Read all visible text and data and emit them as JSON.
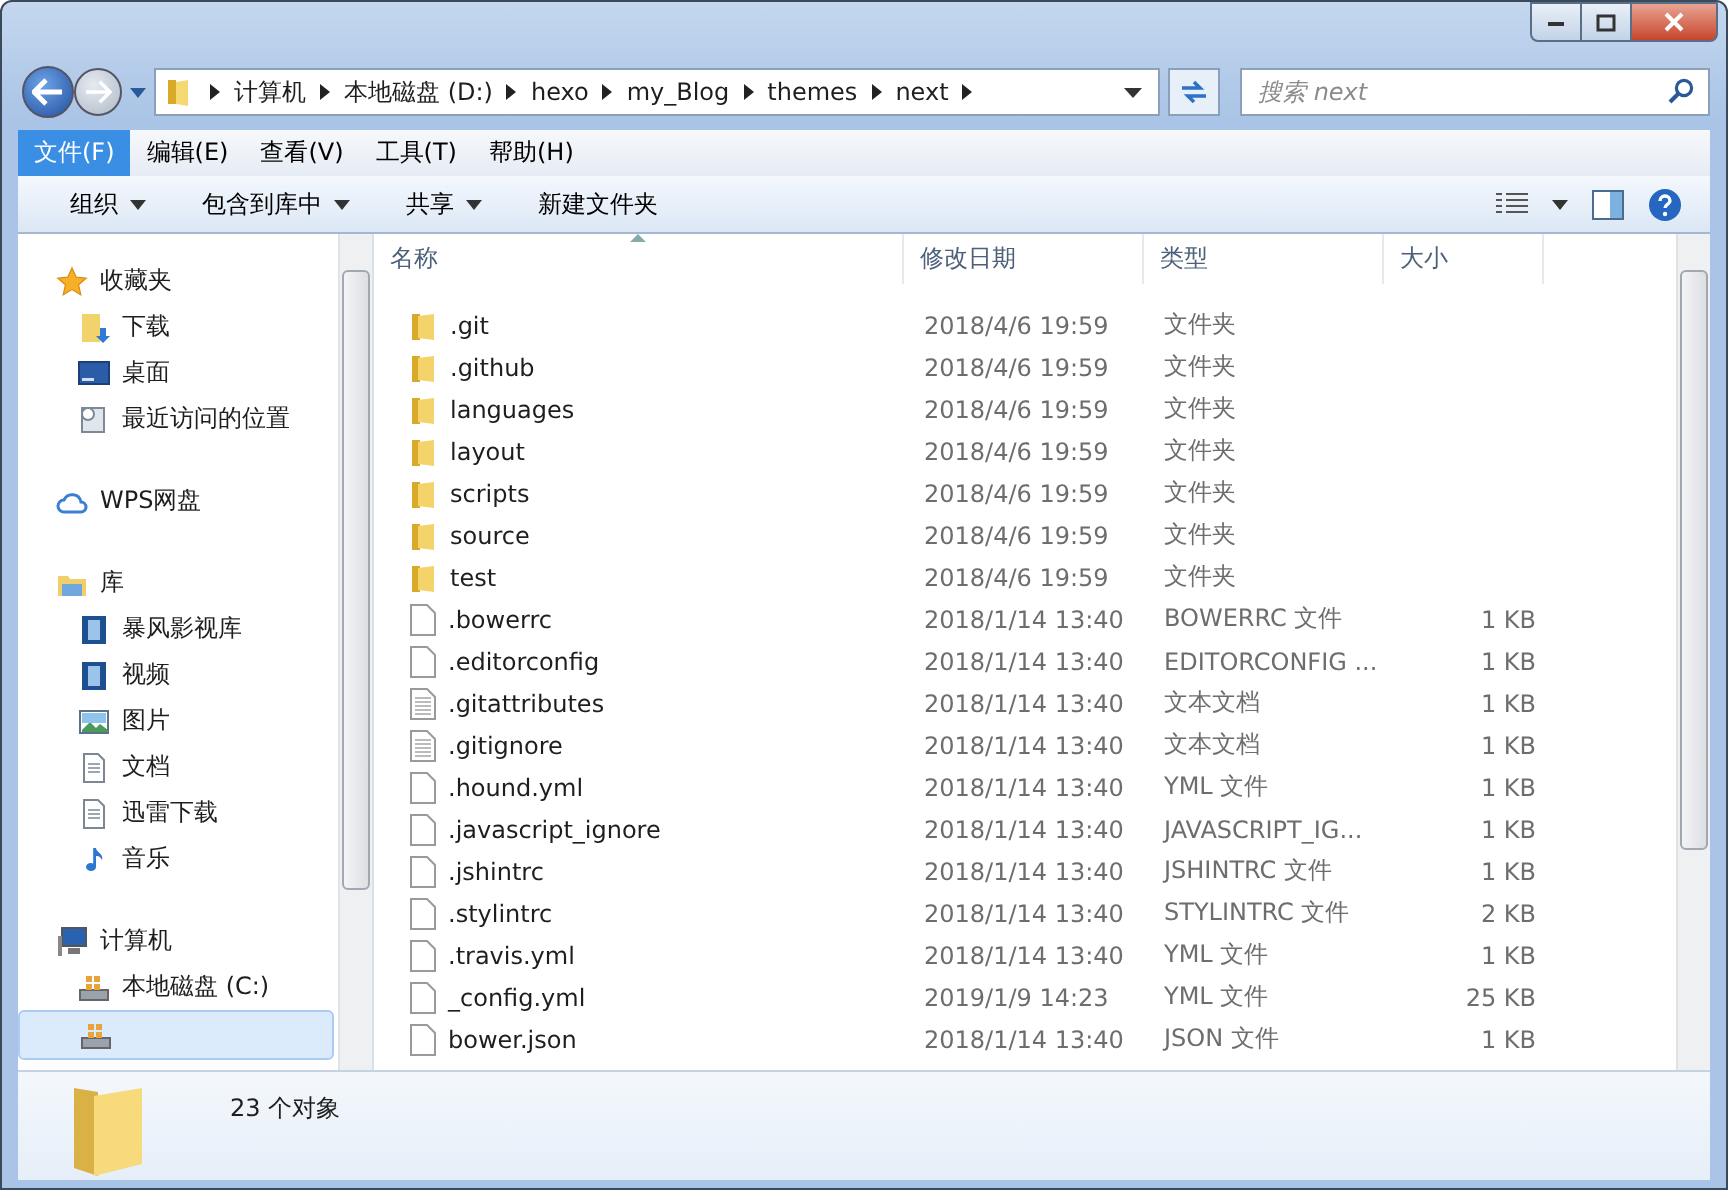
{
  "address": {
    "crumbs": [
      "计算机",
      "本地磁盘 (D:)",
      "hexo",
      "my_Blog",
      "themes",
      "next"
    ]
  },
  "search": {
    "placeholder": "搜索 next"
  },
  "menu": [
    {
      "label": "文件(F)",
      "selected": true
    },
    {
      "label": "编辑(E)",
      "selected": false
    },
    {
      "label": "查看(V)",
      "selected": false
    },
    {
      "label": "工具(T)",
      "selected": false
    },
    {
      "label": "帮助(H)",
      "selected": false
    }
  ],
  "toolbar": [
    {
      "label": "组织",
      "dropdown": true
    },
    {
      "label": "包含到库中",
      "dropdown": true
    },
    {
      "label": "共享",
      "dropdown": true
    },
    {
      "label": "新建文件夹",
      "dropdown": false
    }
  ],
  "sidebar": {
    "groups": [
      {
        "label": "收藏夹",
        "kind": "star",
        "children": [
          {
            "label": "下载",
            "kind": "download"
          },
          {
            "label": "桌面",
            "kind": "desktop"
          },
          {
            "label": "最近访问的位置",
            "kind": "recent"
          }
        ]
      },
      {
        "label": "WPS网盘",
        "kind": "cloud"
      },
      {
        "label": "库",
        "kind": "library",
        "children": [
          {
            "label": "暴风影视库",
            "kind": "film"
          },
          {
            "label": "视频",
            "kind": "film"
          },
          {
            "label": "图片",
            "kind": "picture"
          },
          {
            "label": "文档",
            "kind": "document"
          },
          {
            "label": "迅雷下载",
            "kind": "document"
          },
          {
            "label": "音乐",
            "kind": "music"
          }
        ]
      },
      {
        "label": "计算机",
        "kind": "computer",
        "children": [
          {
            "label": "本地磁盘 (C:)",
            "kind": "drive",
            "selected": false
          },
          {
            "kind": "drive",
            "selected": true
          }
        ]
      }
    ]
  },
  "table": {
    "columns": [
      {
        "label": "名称",
        "sorted": true
      },
      {
        "label": "修改日期",
        "sorted": false
      },
      {
        "label": "类型",
        "sorted": false
      },
      {
        "label": "大小",
        "sorted": false
      }
    ],
    "rows": [
      {
        "kind": "folder",
        "name": ".git",
        "date": "2018/4/6 19:59",
        "type": "文件夹"
      },
      {
        "kind": "folder",
        "name": ".github",
        "date": "2018/4/6 19:59",
        "type": "文件夹"
      },
      {
        "kind": "folder",
        "name": "languages",
        "date": "2018/4/6 19:59",
        "type": "文件夹"
      },
      {
        "kind": "folder",
        "name": "layout",
        "date": "2018/4/6 19:59",
        "type": "文件夹"
      },
      {
        "kind": "folder",
        "name": "scripts",
        "date": "2018/4/6 19:59",
        "type": "文件夹"
      },
      {
        "kind": "folder",
        "name": "source",
        "date": "2018/4/6 19:59",
        "type": "文件夹"
      },
      {
        "kind": "folder",
        "name": "test",
        "date": "2018/4/6 19:59",
        "type": "文件夹"
      },
      {
        "kind": "file",
        "name": ".bowerrc",
        "date": "2018/1/14 13:40",
        "type": "BOWERRC 文件",
        "size": "1 KB"
      },
      {
        "kind": "file",
        "name": ".editorconfig",
        "date": "2018/1/14 13:40",
        "type": "EDITORCONFIG ...",
        "size": "1 KB"
      },
      {
        "kind": "text",
        "name": ".gitattributes",
        "date": "2018/1/14 13:40",
        "type": "文本文档",
        "size": "1 KB"
      },
      {
        "kind": "text",
        "name": ".gitignore",
        "date": "2018/1/14 13:40",
        "type": "文本文档",
        "size": "1 KB"
      },
      {
        "kind": "file",
        "name": ".hound.yml",
        "date": "2018/1/14 13:40",
        "type": "YML 文件",
        "size": "1 KB"
      },
      {
        "kind": "file",
        "name": ".javascript_ignore",
        "date": "2018/1/14 13:40",
        "type": "JAVASCRIPT_IG...",
        "size": "1 KB"
      },
      {
        "kind": "file",
        "name": ".jshintrc",
        "date": "2018/1/14 13:40",
        "type": "JSHINTRC 文件",
        "size": "1 KB"
      },
      {
        "kind": "file",
        "name": ".stylintrc",
        "date": "2018/1/14 13:40",
        "type": "STYLINTRC 文件",
        "size": "2 KB"
      },
      {
        "kind": "file",
        "name": ".travis.yml",
        "date": "2018/1/14 13:40",
        "type": "YML 文件",
        "size": "1 KB"
      },
      {
        "kind": "file",
        "name": "_config.yml",
        "date": "2019/1/9 14:23",
        "type": "YML 文件",
        "size": "25 KB"
      },
      {
        "kind": "file",
        "name": "bower.json",
        "date": "2018/1/14 13:40",
        "type": "JSON 文件",
        "size": "1 KB"
      }
    ]
  },
  "status_bar": {
    "count": "23 个对象"
  }
}
